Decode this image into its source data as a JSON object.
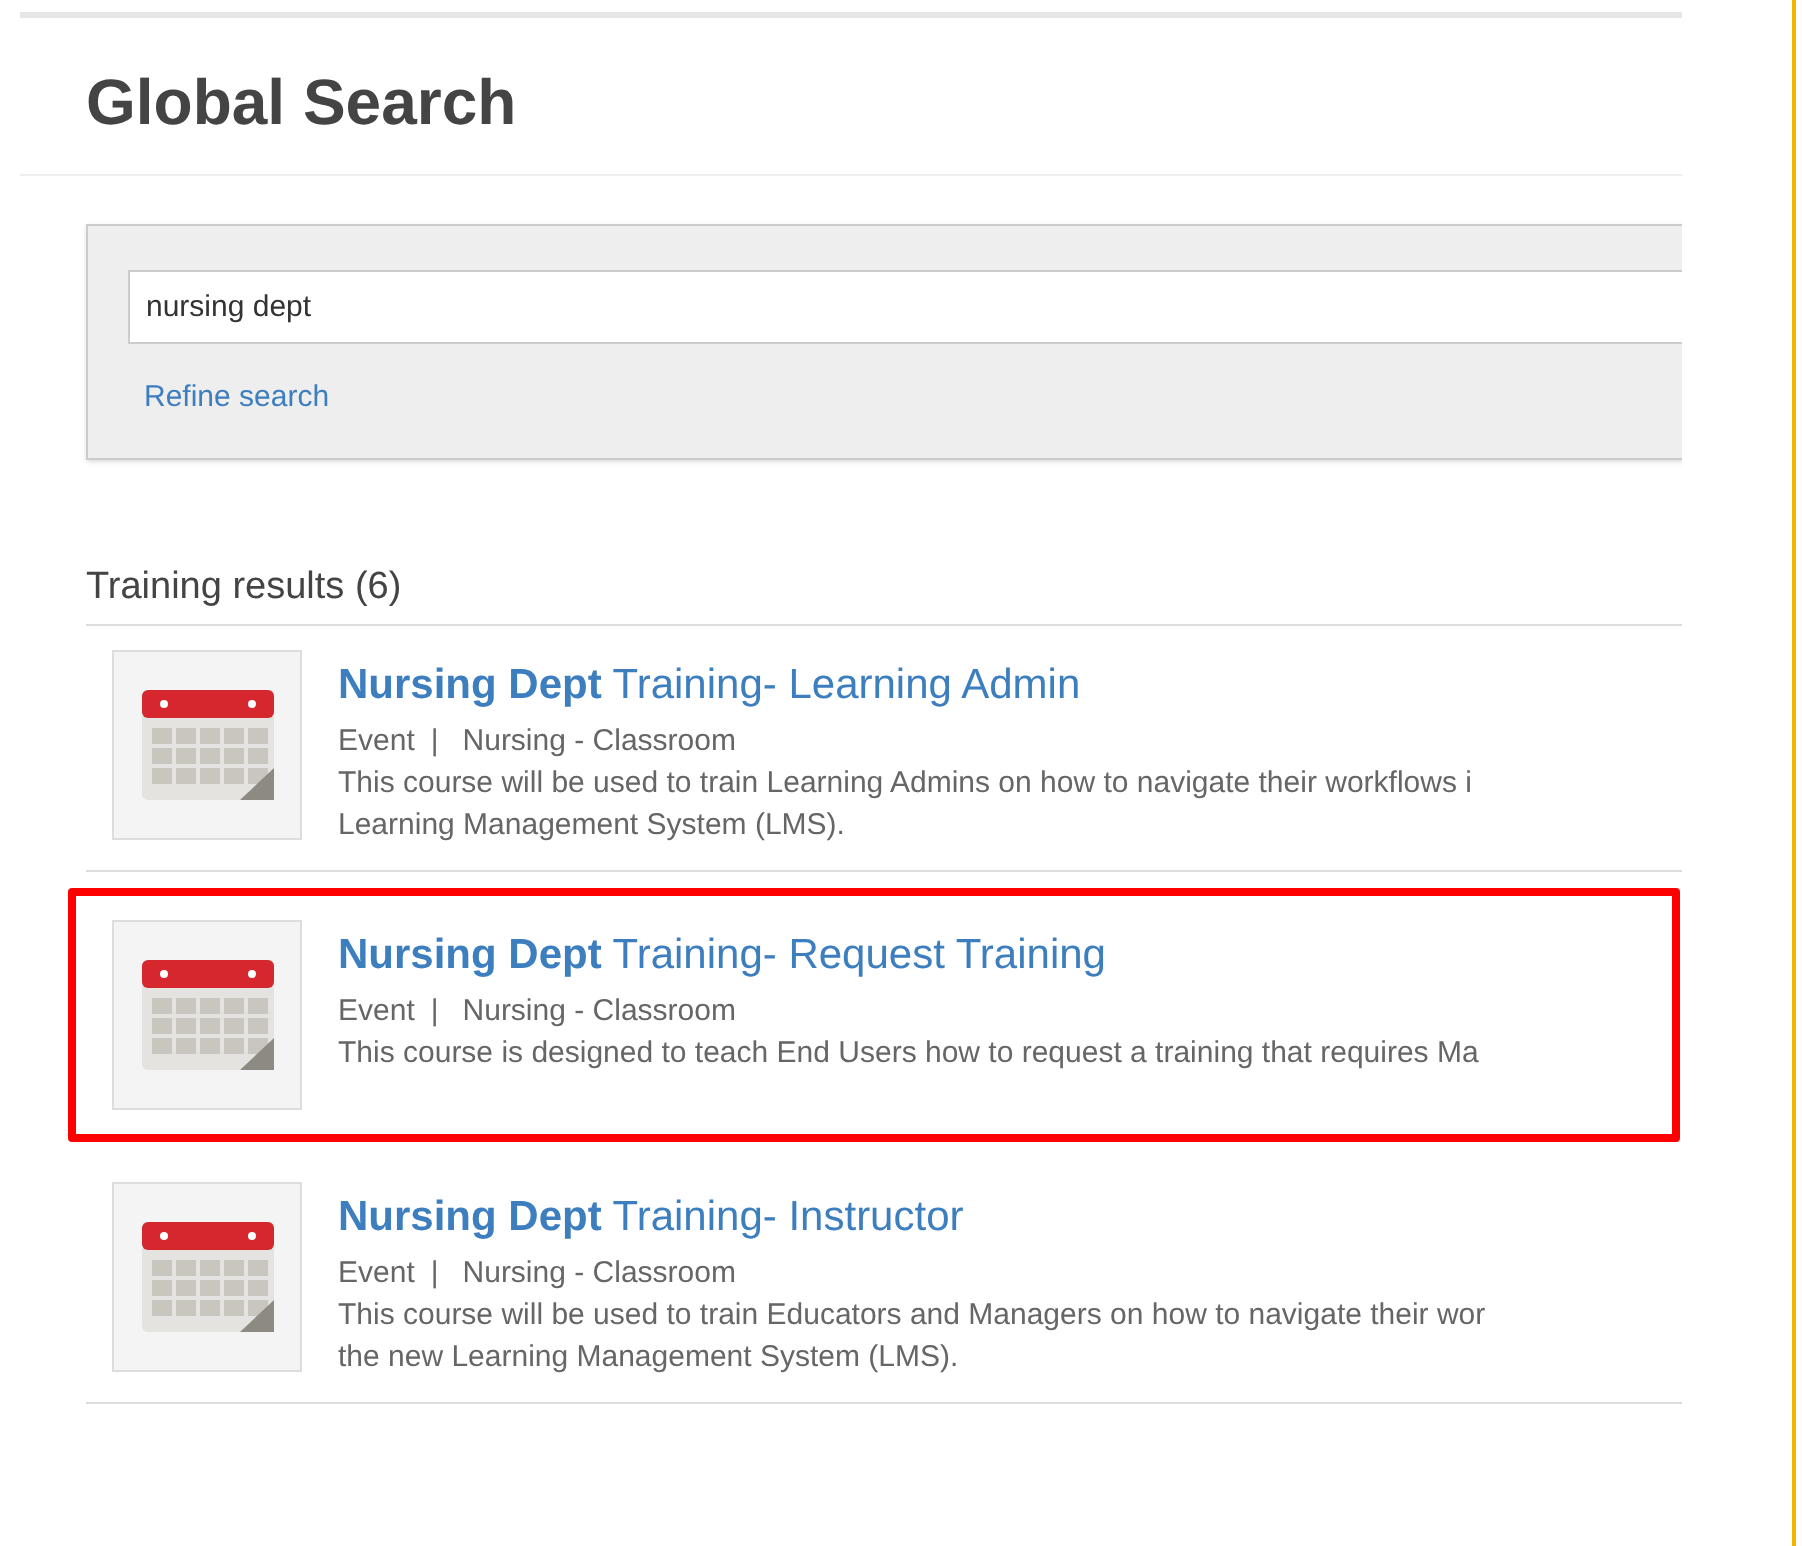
{
  "page": {
    "title": "Global Search"
  },
  "search": {
    "value": "nursing dept",
    "refine_link": "Refine search"
  },
  "results_heading": "Training results (6)",
  "results": [
    {
      "title": "**Nursing Dept** Training- Learning Admin",
      "meta_type": "Event",
      "separator": "|",
      "meta_category": "Nursing - Classroom",
      "description_lines": [
        "This course will be used to train Learning Admins on how to navigate their workflows i",
        "Learning Management System (LMS)."
      ],
      "highlighted": false
    },
    {
      "title": "**Nursing Dept** Training- Request Training",
      "meta_type": "Event",
      "separator": "|",
      "meta_category": "Nursing - Classroom",
      "description_lines": [
        "This course is designed to teach End Users how to request a training that requires Ma"
      ],
      "highlighted": true
    },
    {
      "title": "**Nursing Dept** Training- Instructor",
      "meta_type": "Event",
      "separator": "|",
      "meta_category": "Nursing - Classroom",
      "description_lines": [
        "This course will be used to train Educators and Managers on how to navigate their wor",
        "the new Learning Management System (LMS)."
      ],
      "highlighted": false
    }
  ]
}
